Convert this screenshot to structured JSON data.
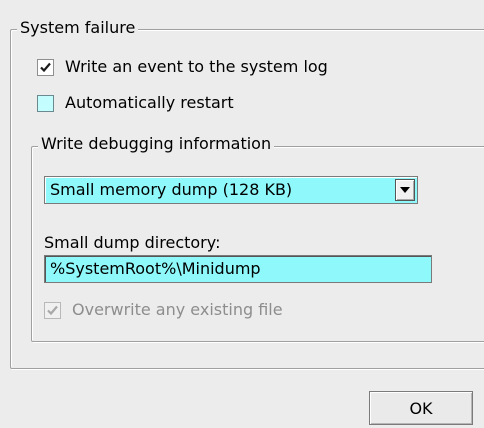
{
  "system_failure": {
    "group_title": "System failure",
    "write_event": {
      "label": "Write an event to the system log",
      "checked": true
    },
    "auto_restart": {
      "label": "Automatically restart",
      "checked": false
    }
  },
  "debugging": {
    "group_title": "Write debugging information",
    "dump_type": {
      "selected": "Small memory dump (128 KB)",
      "icon": "chevron-down-icon"
    },
    "directory": {
      "label": "Small dump directory:",
      "value": "%SystemRoot%\\Minidump"
    },
    "overwrite": {
      "label": "Overwrite any existing file",
      "checked": true,
      "enabled": false
    }
  },
  "buttons": {
    "ok_label": "OK"
  },
  "colors": {
    "field_highlight": "#8ef8fb",
    "dialog_background": "#ececec"
  }
}
